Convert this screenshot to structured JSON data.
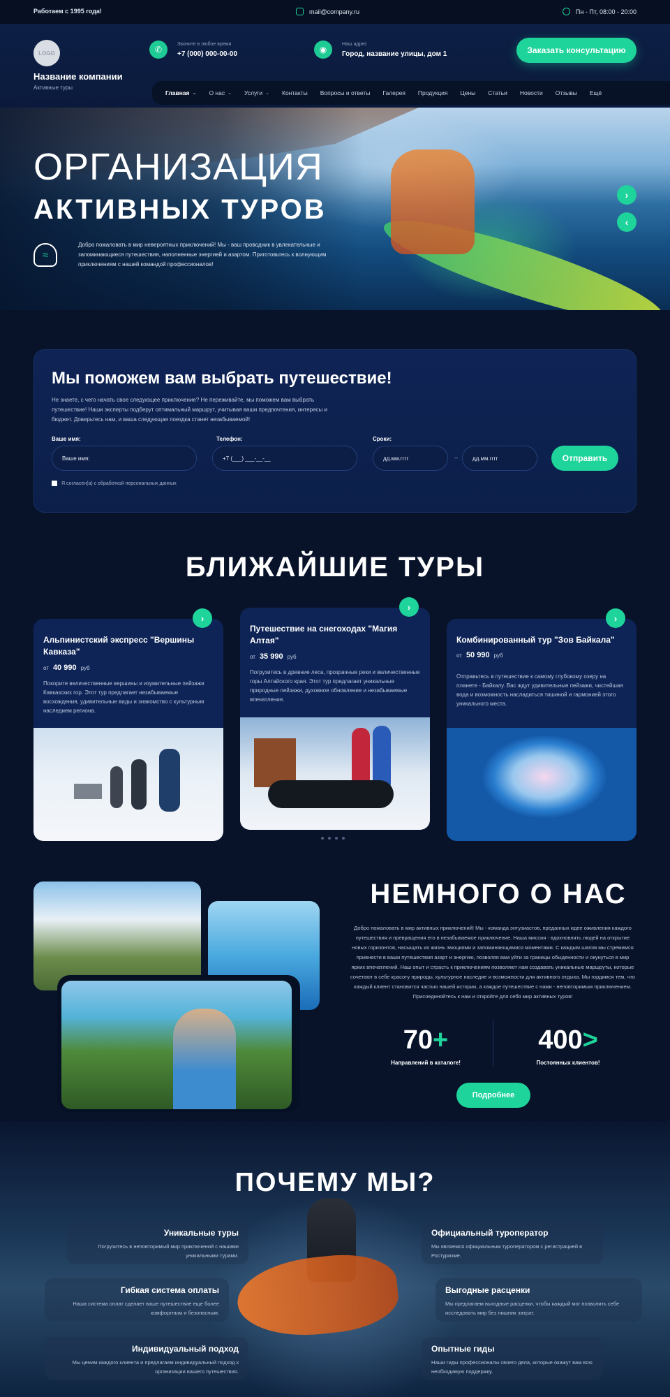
{
  "topbar": {
    "since": "Работаем с 1995 года!",
    "email": "mail@company.ru",
    "hours": "Пн - Пт, 08:00 - 20:00"
  },
  "header": {
    "logo": "LOGO",
    "company_name": "Название компании",
    "company_sub": "Активные туры",
    "phone_label": "Звоните в любое время",
    "phone": "+7 (000) 000-00-00",
    "address_label": "Наш адрес",
    "address": "Город, название улицы, дом 1",
    "cta": "Заказать консультацию"
  },
  "nav": {
    "items": [
      {
        "label": "Главная",
        "dropdown": true
      },
      {
        "label": "О нас",
        "dropdown": true
      },
      {
        "label": "Услуги",
        "dropdown": true
      },
      {
        "label": "Контакты",
        "dropdown": false
      },
      {
        "label": "Вопросы и ответы",
        "dropdown": false
      },
      {
        "label": "Галерея",
        "dropdown": false
      },
      {
        "label": "Продукция",
        "dropdown": false
      },
      {
        "label": "Цены",
        "dropdown": false
      },
      {
        "label": "Статьи",
        "dropdown": false
      },
      {
        "label": "Новости",
        "dropdown": false
      },
      {
        "label": "Отзывы",
        "dropdown": false
      },
      {
        "label": "Ещё",
        "dropdown": false
      }
    ]
  },
  "hero": {
    "title1": "ОРГАНИЗАЦИЯ",
    "title2": "АКТИВНЫХ ТУРОВ",
    "text": "Добро пожаловать в мир невероятных приключений! Мы - ваш проводник в увлекательные и запоминающиеся путешествия, наполненные энергией и азартом. Приготовьтесь к волнующим приключениям с нашей командой профессионалов!",
    "next": "›",
    "prev": "‹"
  },
  "form": {
    "title": "Мы поможем вам выбрать путешествие!",
    "desc": "Не знаете, с чего начать свое следующее приключение? Не переживайте, мы поможем вам выбрать путешествие! Наши эксперты подберут оптимальный маршрут, учитывая ваши предпочтения, интересы и бюджет. Доверьтесь нам, и ваша следующая поездка станет незабываемой!",
    "name_label": "Ваше имя:",
    "name_placeholder": "Ваше имя:",
    "phone_label": "Телефон:",
    "phone_placeholder": "+7 (___) ___-__-__",
    "dates_label": "Сроки:",
    "date_from": "дд.мм.гггг",
    "date_sep": "–",
    "date_to": "дд.мм.гггг",
    "submit": "Отправить",
    "consent": "Я согласен(а) с обработкой персональных данных"
  },
  "tours": {
    "title": "БЛИЖАЙШИЕ ТУРЫ",
    "price_prefix": "от",
    "currency": "руб",
    "items": [
      {
        "name": "Альпинистский экспресс \"Вершины Кавказа\"",
        "price": "40 990",
        "desc": "Покорите величественные вершины и изумительные пейзажи Кавказских гор. Этот тур предлагает незабываемые восхождения, удивительные виды и знакомство с культурным наследием региона."
      },
      {
        "name": "Путешествие на снегоходах \"Магия Алтая\"",
        "price": "35 990",
        "desc": "Погрузитесь в древние леса, прозрачные реки и величественные горы Алтайского края. Этот тур предлагает уникальные природные пейзажи, духовное обновление и незабываемые впечатления."
      },
      {
        "name": "Комбинированный тур \"Зов Байкала\"",
        "price": "50 990",
        "desc": "Отправьтесь в путешествие к самому глубокому озеру на планете - Байкалу. Вас ждут удивительные пейзажи, чистейшая вода и возможность насладиться тишиной и гармонией этого уникального места."
      }
    ]
  },
  "about": {
    "title": "НЕМНОГО О НАС",
    "text": "Добро пожаловать в мир активных приключений! Мы - команда энтузиастов, преданных идее оживления каждого путешествия и превращения его в незабываемое приключение. Наша миссия - вдохновлять людей на открытие новых горизонтов, насыщать их жизнь эмоциями и запоминающимися моментами. С каждым шагом мы стремимся привнести в ваши путешествия азарт и энергию, позволяя вам уйти за границы обыденности и окунуться в мир ярких впечатлений. Наш опыт и страсть к приключениям позволяют нам создавать уникальные маршруты, которые сочетают в себе красоту природы, культурное наследие и возможности для активного отдыха. Мы гордимся тем, что каждый клиент становится частью нашей истории, а каждое путешествие с нами - неповторимым приключением. Присоединяйтесь к нам и откройте для себя мир активных туров!",
    "stat1_num": "70",
    "stat1_suffix": "+",
    "stat1_label": "Направлений в каталоге!",
    "stat2_num": "400",
    "stat2_suffix": ">",
    "stat2_label": "Постоянных клиентов!",
    "more": "Подробнее"
  },
  "why": {
    "title": "ПОЧЕМУ МЫ?",
    "items": [
      {
        "title": "Уникальные туры",
        "text": "Погрузитесь в неповторимый мир приключений с нашими уникальными турами."
      },
      {
        "title": "Официальный туроператор",
        "text": "Мы являемся официальным туроператором с регистрацией в Ростуризме."
      },
      {
        "title": "Гибкая система оплаты",
        "text": "Наша система оплат сделает ваше путешествие еще более комфортным и безопасным."
      },
      {
        "title": "Выгодные расценки",
        "text": "Мы предлагаем выгодные расценки, чтобы каждый мог позволить себе исследовать мир без лишних затрат."
      },
      {
        "title": "Индивидуальный подход",
        "text": "Мы ценим каждого клиента и предлагаем индивидуальный подход к организации вашего путешествия."
      },
      {
        "title": "Опытные гиды",
        "text": "Наши гиды профессионалы своего дела, которые окажут вам всю необходимую поддержку."
      }
    ]
  },
  "colors": {
    "accent": "#1ed49a",
    "background": "#08132a",
    "card": "#0e2456"
  }
}
